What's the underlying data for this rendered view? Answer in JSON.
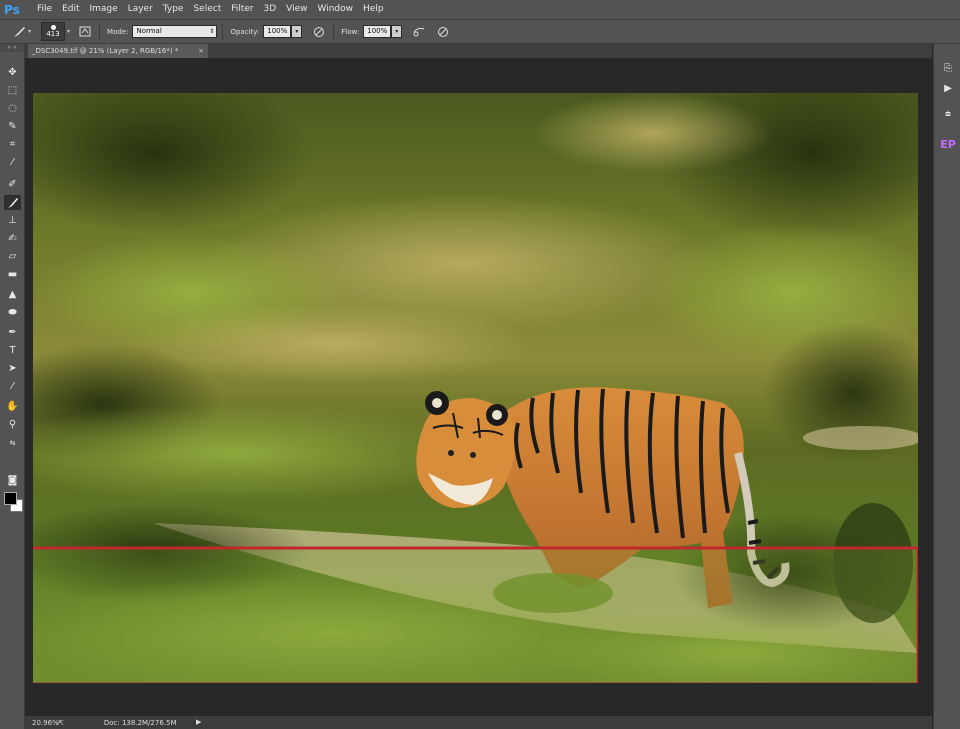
{
  "app": {
    "logo": "Ps"
  },
  "menu": [
    "File",
    "Edit",
    "Image",
    "Layer",
    "Type",
    "Select",
    "Filter",
    "3D",
    "View",
    "Window",
    "Help"
  ],
  "options": {
    "brush_size": "413",
    "mode_label": "Mode:",
    "mode_value": "Normal",
    "opacity_label": "Opacity:",
    "opacity_value": "100%",
    "flow_label": "Flow:",
    "flow_value": "100%"
  },
  "document": {
    "tab_title": "_DSC3049.tif @ 21% (Layer 2, RGB/16*) *",
    "close_glyph": "×"
  },
  "status": {
    "zoom": "20.96%",
    "doc_size": "Doc: 138.2M/276.5M"
  },
  "colors": {
    "selection_box": "#c0282d",
    "accent": "#3ba2f5",
    "ep_panel": "#c86bff"
  },
  "icons": {
    "tools": [
      "move-icon",
      "marquee-icon",
      "lasso-icon",
      "quick-select-icon",
      "crop-icon",
      "eyedropper-icon",
      "healing-brush-icon",
      "brush-icon",
      "clone-stamp-icon",
      "history-brush-icon",
      "eraser-icon",
      "gradient-icon",
      "blur-icon",
      "dodge-icon",
      "pen-icon",
      "type-icon",
      "path-select-icon",
      "line-icon",
      "hand-icon",
      "zoom-icon"
    ],
    "right_dock": [
      "history-icon",
      "actions-icon",
      "layers-icon",
      "ep-panel-icon"
    ]
  },
  "dock": {
    "ep_label": "EP"
  }
}
